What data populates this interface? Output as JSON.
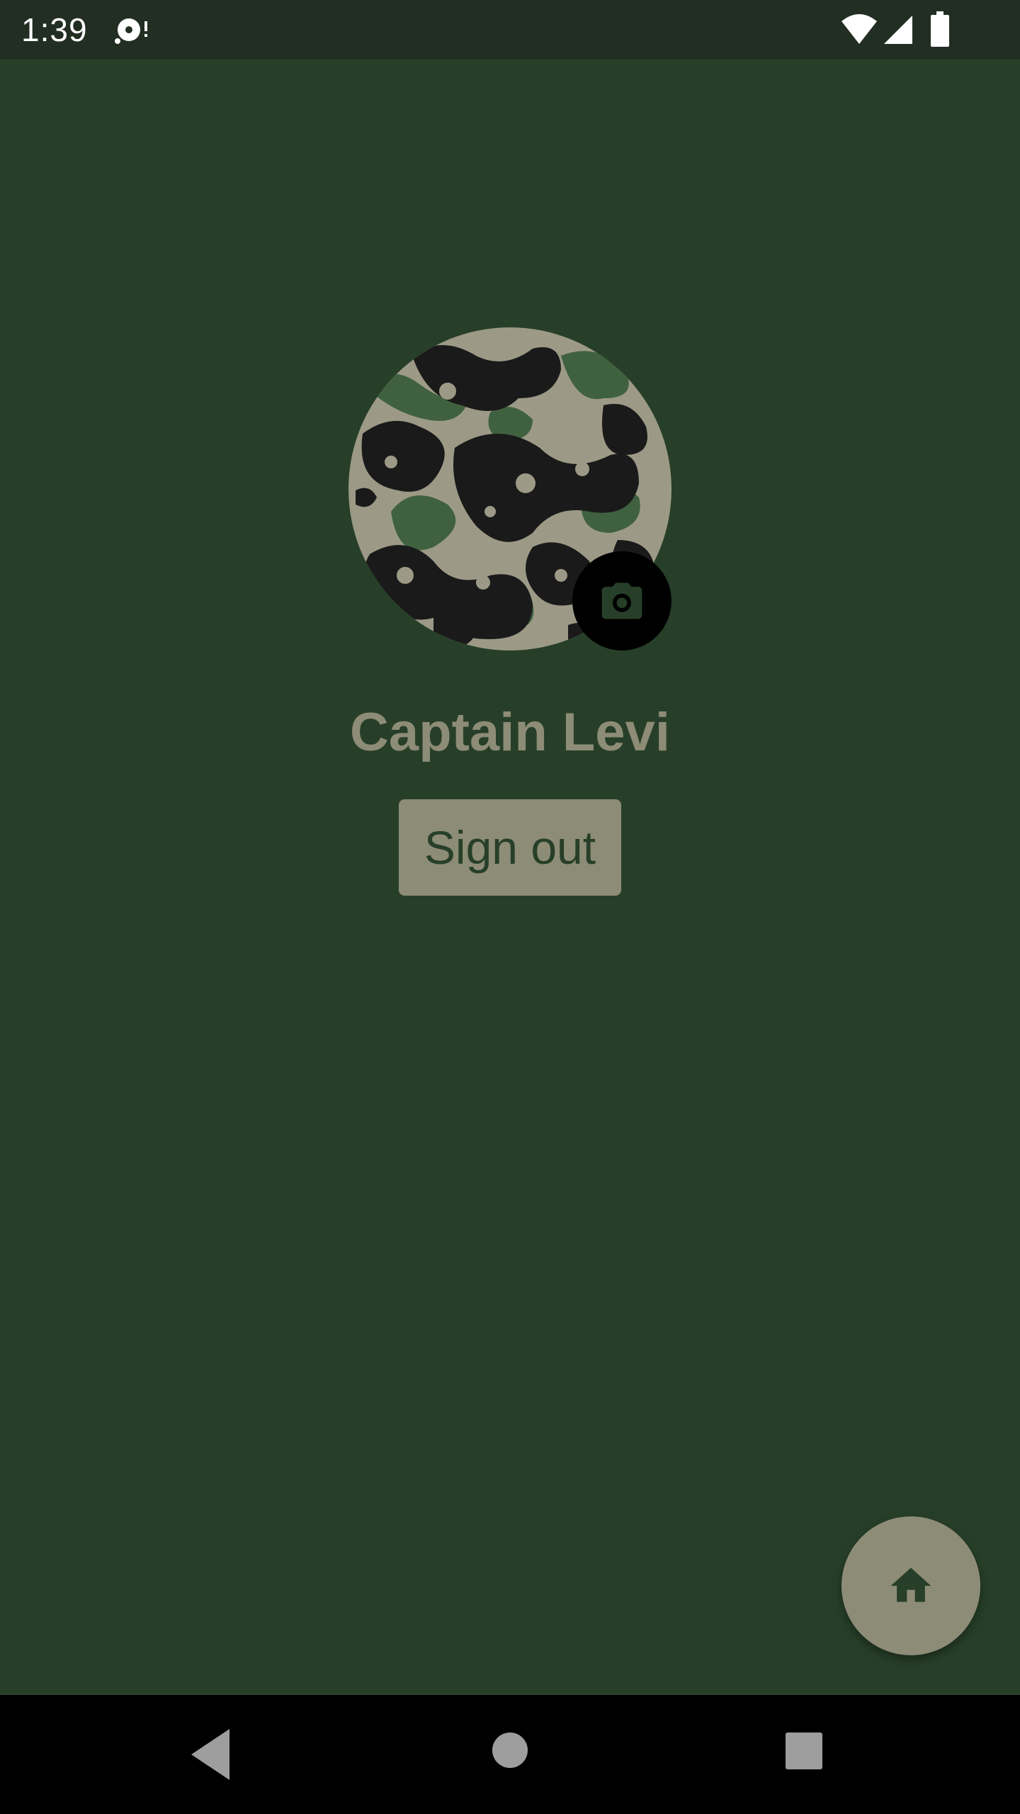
{
  "status_bar": {
    "time": "1:39",
    "icons": [
      "media-icon",
      "wifi-icon",
      "signal-icon",
      "battery-icon"
    ]
  },
  "profile": {
    "name": "Captain Levi",
    "avatar_pattern": "camouflage",
    "camera_icon": "camera-icon"
  },
  "actions": {
    "sign_out_label": "Sign out",
    "home_icon": "home-icon"
  },
  "nav_bar": {
    "icons": [
      "back-icon",
      "home-circle-icon",
      "recents-icon"
    ]
  },
  "colors": {
    "background": "#273f28",
    "status_bar": "#212e21",
    "accent": "#8d8c77",
    "camo_dark": "#1a1a1a",
    "camo_green": "#3f6140",
    "camo_tan": "#9c9a86"
  }
}
